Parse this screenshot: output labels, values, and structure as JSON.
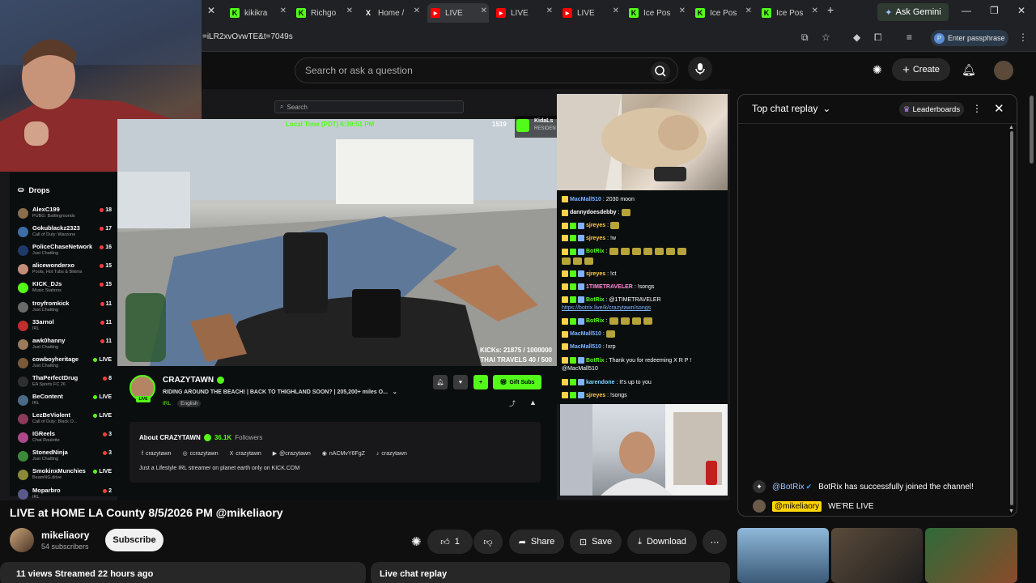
{
  "tabs": [
    {
      "label": "kikikra",
      "icon": "kick-icon",
      "color": "#53fc18"
    },
    {
      "label": "Richgo",
      "icon": "kick-icon",
      "color": "#53fc18"
    },
    {
      "label": "Home /",
      "icon": "x-icon",
      "color": "#ffffff"
    },
    {
      "label": "LIVE",
      "icon": "youtube-icon",
      "color": "#ff0000"
    },
    {
      "label": "LIVE",
      "icon": "youtube-icon",
      "color": "#ff0000"
    },
    {
      "label": "LIVE",
      "icon": "youtube-icon",
      "color": "#ff0000"
    },
    {
      "label": "Ice Pos",
      "icon": "kick-icon",
      "color": "#53fc18"
    },
    {
      "label": "Ice Pos",
      "icon": "kick-icon",
      "color": "#53fc18"
    },
    {
      "label": "Ice Pos",
      "icon": "kick-icon",
      "color": "#53fc18"
    }
  ],
  "ask_gemini": "Ask Gemini",
  "address": "=iLR2xvOvwTE&t=7049s",
  "passphrase": "Enter passphrase",
  "header": {
    "search_placeholder": "Search or ask a question",
    "create_label": "Create"
  },
  "kick": {
    "search_placeholder": "Search",
    "drops_label": "Drops",
    "local_time": "Local Time (PDT) 6:39:51 PM",
    "viewers": "1519",
    "badge_name": "KidaLs",
    "badge_sub": "RESIDEN",
    "kicks_goal": "KICKs: 21875 / 1000000",
    "thai_goal": "THAI TRAVELS 40 / 500",
    "sidebar": [
      {
        "name": "AlexC199",
        "category": "PUBG: Battlegrounds",
        "count": "18",
        "live": false,
        "color": "#8a6d4b"
      },
      {
        "name": "Gokublackz2323",
        "category": "Call of Duty: Warzone",
        "count": "17",
        "live": false,
        "color": "#3a6ea5"
      },
      {
        "name": "PoliceChaseNetwork",
        "category": "Just Chatting",
        "count": "16",
        "live": false,
        "color": "#1d3a6b"
      },
      {
        "name": "alicewonderxo",
        "category": "Pools, Hot Tubs & Bikinis",
        "count": "15",
        "live": false,
        "color": "#c48d7a"
      },
      {
        "name": "KICK_DJs",
        "category": "Music Stations",
        "count": "15",
        "live": false,
        "color": "#53fc18"
      },
      {
        "name": "troyfromkick",
        "category": "Just Chatting",
        "count": "11",
        "live": false,
        "color": "#6a6a6a"
      },
      {
        "name": "33arnol",
        "category": "IRL",
        "count": "11",
        "live": false,
        "color": "#c22d2d"
      },
      {
        "name": "awk0hanny",
        "category": "Just Chatting",
        "count": "11",
        "live": false,
        "color": "#9a7a5a"
      },
      {
        "name": "cowboyheritage",
        "category": "Just Chatting",
        "count": "LIVE",
        "live": true,
        "color": "#7a5a3a"
      },
      {
        "name": "ThaPerfectDrug",
        "category": "EA Sports FC 26",
        "count": "8",
        "live": false,
        "color": "#2f2f2f"
      },
      {
        "name": "BeContent",
        "category": "IRL",
        "count": "LIVE",
        "live": true,
        "color": "#4a6a8a"
      },
      {
        "name": "LezBeViolent",
        "category": "Call of Duty: Black O...",
        "count": "LIVE",
        "live": true,
        "color": "#8a3a5a"
      },
      {
        "name": "IGReels",
        "category": "Chat Roulette",
        "count": "3",
        "live": false,
        "color": "#aa4a8a"
      },
      {
        "name": "StonedNinja",
        "category": "Just Chatting",
        "count": "3",
        "live": false,
        "color": "#3a8a3a"
      },
      {
        "name": "SmokinxMunchies",
        "category": "BeamNG.drive",
        "count": "LIVE",
        "live": true,
        "color": "#8a8a3a"
      },
      {
        "name": "Moparbro",
        "category": "IRL",
        "count": "2",
        "live": false,
        "color": "#5a5a8a"
      }
    ],
    "chat": [
      {
        "user": "MacMall510",
        "user_color": "#7fb3ff",
        "text": ": 2030 moon",
        "emotes": 0
      },
      {
        "user": "dannydoesdebby",
        "user_color": "#ffffff",
        "text": ":",
        "emotes": 1
      },
      {
        "user": "sjreyes",
        "user_color": "#ffd24a",
        "text": ":",
        "emotes": 1
      },
      {
        "user": "sjreyes",
        "user_color": "#ffd24a",
        "text": ": !w",
        "emotes": 0
      },
      {
        "user": "BotRix",
        "user_color": "#53fc18",
        "text": ":",
        "emotes": 7
      },
      {
        "user": "",
        "user_color": "#ffffff",
        "text": "",
        "emotes": 3
      },
      {
        "user": "sjreyes",
        "user_color": "#ffd24a",
        "text": ": !ct",
        "emotes": 0
      },
      {
        "user": "1TIMETRAVELER",
        "user_color": "#ff8ad8",
        "text": ": !songs",
        "emotes": 0
      },
      {
        "user": "BotRix",
        "user_color": "#53fc18",
        "text": ": @1TIMETRAVELER",
        "emotes": 0
      },
      {
        "user": "",
        "user_color": "#7fb3ff",
        "text": "https://botrix.live/k/crazytawn/songs",
        "emotes": 0
      },
      {
        "user": "BotRix",
        "user_color": "#53fc18",
        "text": ":",
        "emotes": 4
      },
      {
        "user": "MacMall510",
        "user_color": "#7fb3ff",
        "text": ":",
        "emotes": 1
      },
      {
        "user": "MacMall510",
        "user_color": "#7fb3ff",
        "text": ": !xrp",
        "emotes": 0
      },
      {
        "user": "BotRix",
        "user_color": "#53fc18",
        "text": ": Thank you for redeeming X R P !",
        "emotes": 0
      },
      {
        "user": "",
        "user_color": "#ffffff",
        "text": "@MacMall510",
        "emotes": 0
      },
      {
        "user": "karendone",
        "user_color": "#7fd8ff",
        "text": ": It's up to you",
        "emotes": 0
      },
      {
        "user": "sjreyes",
        "user_color": "#ffd24a",
        "text": ": !songs",
        "emotes": 0
      }
    ],
    "streamer": {
      "name": "CRAZYTAWN",
      "title": "RIDING AROUND THE BEACH! | BACK TO THIGHLAND SOON? | 205,200+ miles O...",
      "tag_irl": "IRL",
      "tag_lang": "English",
      "live_badge": "LIVE",
      "gift_subs": "Gift Subs",
      "about_title": "About CRAZYTAWN",
      "followers_count": "36.1K",
      "followers_label": "Followers",
      "socials": [
        {
          "icon": "facebook-icon",
          "handle": "crazytawn"
        },
        {
          "icon": "instagram-icon",
          "handle": "ccrazytawn"
        },
        {
          "icon": "x-icon",
          "handle": "crazytawn"
        },
        {
          "icon": "youtube-icon",
          "handle": "@crazytawn"
        },
        {
          "icon": "discord-icon",
          "handle": "nACMvY6FgZ"
        },
        {
          "icon": "tiktok-icon",
          "handle": "crazytawn"
        }
      ],
      "description": "Just a Lifestyle IRL streamer on planet earth only on KICK.COM"
    }
  },
  "ytchat": {
    "mode": "Top chat replay",
    "leaderboards": "Leaderboards",
    "messages": [
      {
        "user": "@BotRix",
        "text": "BotRix has successfully joined the channel!",
        "owner": false
      },
      {
        "user": "@mikeliaory",
        "text": "WE'RE LIVE",
        "owner": true
      }
    ]
  },
  "video": {
    "title": "LIVE at HOME LA County 8/5/2026 PM @mikeliaory",
    "channel": "mikeliaory",
    "subscribers": "54 subscribers",
    "subscribe_label": "Subscribe",
    "likes": "1",
    "share_label": "Share",
    "save_label": "Save",
    "download_label": "Download",
    "meta": "11 views  Streamed 22 hours ago",
    "live_chat_replay": "Live chat replay"
  }
}
